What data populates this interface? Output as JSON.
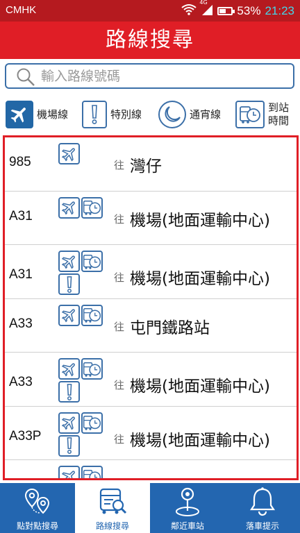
{
  "status_bar": {
    "carrier": "CMHK",
    "network": "4G",
    "battery": "53%",
    "battery_level": 0.53,
    "time": "21:23"
  },
  "header": {
    "title": "路線搜尋"
  },
  "search": {
    "placeholder": "輸入路線號碼",
    "value": ""
  },
  "legend": [
    {
      "icon": "airplane-icon",
      "label": "機場線"
    },
    {
      "icon": "exclamation-icon",
      "label": "特別線"
    },
    {
      "icon": "moon-icon",
      "label": "通宵線"
    },
    {
      "icon": "bus-clock-icon",
      "label": "到站\n時間"
    }
  ],
  "towards_label": "往",
  "routes": [
    {
      "route": "985",
      "icons": [
        "airplane"
      ],
      "destination": "灣仔"
    },
    {
      "route": "A31",
      "icons": [
        "airplane",
        "bus-clock"
      ],
      "destination": "機場(地面運輸中心)"
    },
    {
      "route": "A31",
      "icons": [
        "airplane",
        "bus-clock",
        "exclamation"
      ],
      "destination": "機場(地面運輸中心)"
    },
    {
      "route": "A33",
      "icons": [
        "airplane",
        "bus-clock"
      ],
      "destination": "屯門鐵路站"
    },
    {
      "route": "A33",
      "icons": [
        "airplane",
        "bus-clock",
        "exclamation"
      ],
      "destination": "機場(地面運輸中心)"
    },
    {
      "route": "A33P",
      "icons": [
        "airplane",
        "bus-clock",
        "exclamation"
      ],
      "destination": "機場(地面運輸中心)"
    },
    {
      "route": "",
      "icons": [
        "airplane",
        "bus-clock"
      ],
      "destination": ""
    }
  ],
  "bottom_nav": [
    {
      "icon": "location-pins-icon",
      "label": "點對點搜尋",
      "active": false
    },
    {
      "icon": "route-search-icon",
      "label": "路線搜尋",
      "active": true
    },
    {
      "icon": "map-pin-icon",
      "label": "鄰近車站",
      "active": false
    },
    {
      "icon": "bell-icon",
      "label": "落車提示",
      "active": false
    }
  ],
  "colors": {
    "header_red": "#e01e26",
    "status_red": "#b51a1f",
    "nav_blue": "#2366b0",
    "icon_blue": "#3b6fa8",
    "time_cyan": "#44d7e8"
  }
}
